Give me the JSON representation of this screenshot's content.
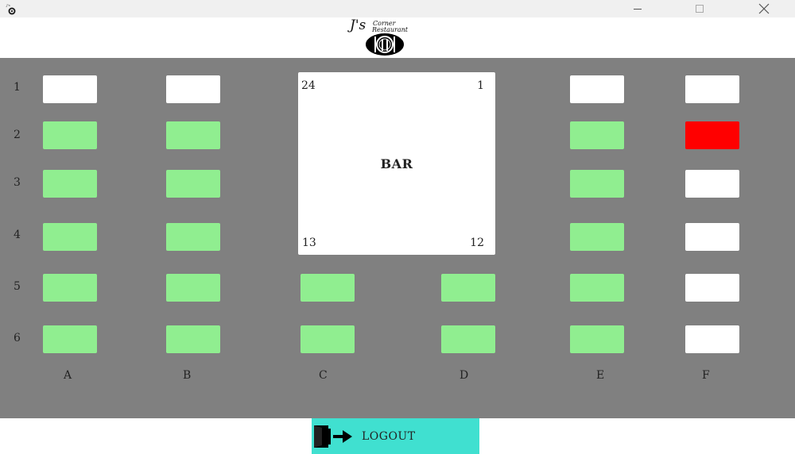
{
  "window": {
    "icon": "restaurant-app-icon",
    "controls": [
      "minimize-icon",
      "maximize-icon",
      "close-icon"
    ]
  },
  "logo": {
    "initials": "J's",
    "line1": "Corner",
    "line2": "Restaurant",
    "emblem": "plate-fork-knife-icon"
  },
  "floor": {
    "background": "#808080",
    "rows": [
      "1",
      "2",
      "3",
      "4",
      "5",
      "6"
    ],
    "columns": [
      "A",
      "B",
      "C",
      "D",
      "E",
      "F"
    ],
    "status_colors": {
      "available": "#ffffff",
      "occupied": "#90ee90",
      "selected": "#ff0000"
    },
    "tables": [
      {
        "id": "A1",
        "status": "available"
      },
      {
        "id": "B1",
        "status": "available"
      },
      {
        "id": "E1",
        "status": "available"
      },
      {
        "id": "F1",
        "status": "available"
      },
      {
        "id": "A2",
        "status": "occupied"
      },
      {
        "id": "B2",
        "status": "occupied"
      },
      {
        "id": "E2",
        "status": "occupied"
      },
      {
        "id": "F2",
        "status": "selected"
      },
      {
        "id": "A3",
        "status": "occupied"
      },
      {
        "id": "B3",
        "status": "occupied"
      },
      {
        "id": "E3",
        "status": "occupied"
      },
      {
        "id": "F3",
        "status": "available"
      },
      {
        "id": "A4",
        "status": "occupied"
      },
      {
        "id": "B4",
        "status": "occupied"
      },
      {
        "id": "E4",
        "status": "occupied"
      },
      {
        "id": "F4",
        "status": "available"
      },
      {
        "id": "A5",
        "status": "occupied"
      },
      {
        "id": "B5",
        "status": "occupied"
      },
      {
        "id": "C5",
        "status": "occupied"
      },
      {
        "id": "D5",
        "status": "occupied"
      },
      {
        "id": "E5",
        "status": "occupied"
      },
      {
        "id": "F5",
        "status": "available"
      },
      {
        "id": "A6",
        "status": "occupied"
      },
      {
        "id": "B6",
        "status": "occupied"
      },
      {
        "id": "C6",
        "status": "occupied"
      },
      {
        "id": "D6",
        "status": "occupied"
      },
      {
        "id": "E6",
        "status": "occupied"
      },
      {
        "id": "F6",
        "status": "available"
      }
    ],
    "bar": {
      "label": "BAR",
      "seat_top_left": "24",
      "seat_top_right": "1",
      "seat_bottom_left": "13",
      "seat_bottom_right": "12"
    }
  },
  "footer": {
    "logout_label": "LOGOUT",
    "logout_icon": "exit-door-icon",
    "logout_color": "#40e0d0"
  }
}
